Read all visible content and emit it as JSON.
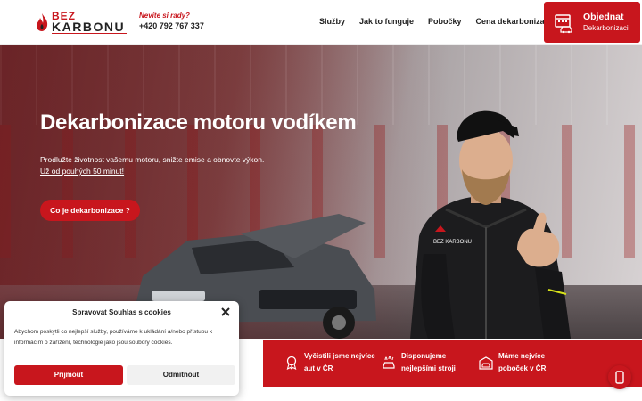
{
  "header": {
    "logo": {
      "line1": "BEZ",
      "line2": "KARBONU"
    },
    "advice": "Nevíte si rady?",
    "phone": "+420 792 767 337",
    "nav": [
      "Služby",
      "Jak to funguje",
      "Pobočky",
      "Cena dekarbonizace"
    ],
    "order_button": {
      "line1": "Objednat",
      "line2": "Dekarbonizaci"
    }
  },
  "hero": {
    "title": "Dekarbonizace motoru vodíkem",
    "subtitle": "Prodlužte životnost vašemu motoru, snižte emise a obnovte výkon.",
    "subtitle2": "Už od pouhých 50 minut!",
    "cta": "Co je dekarbonizace ?",
    "vest_logo": "BEZ KARBONU"
  },
  "features": [
    {
      "icon": "award-icon",
      "lines": [
        "Vyčistili jsme nejvíce",
        "aut v ČR"
      ]
    },
    {
      "icon": "car-wash-icon",
      "lines": [
        "Disponujeme",
        "nejlepšími stroji"
      ]
    },
    {
      "icon": "garage-icon",
      "lines": [
        "Máme nejvíce",
        "poboček v ČR"
      ]
    }
  ],
  "cookie": {
    "title": "Spravovat Souhlas s cookies",
    "text": "Abychom poskytli co nejlepší služby, používáme k ukládání a/nebo přístupu k informacím o zařízení, technologie jako jsou soubory cookies.",
    "accept": "Přijmout",
    "deny": "Odmítnout"
  },
  "colors": {
    "brand": "#c8161d",
    "dark": "#222222"
  }
}
